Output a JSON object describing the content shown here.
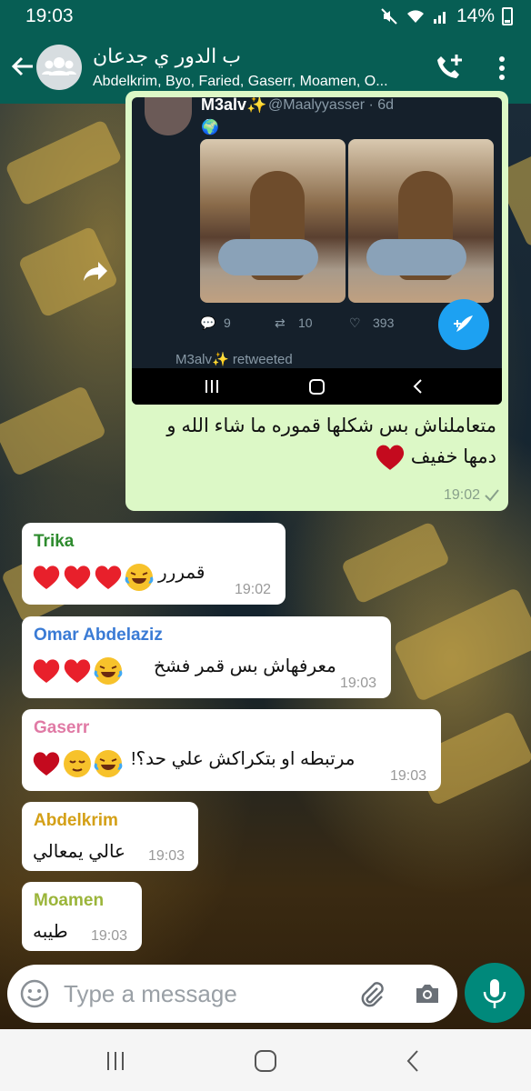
{
  "status_bar": {
    "time": "19:03",
    "battery": "14%"
  },
  "header": {
    "title": "ب الدور ي جدعان",
    "subtitle": "Abdelkrim, Byo, Faried, Gaserr, Moamen, O..."
  },
  "image_message": {
    "tweet": {
      "name": "M3alv✨",
      "handle": "@Maalyyasser · 6d",
      "replies": "9",
      "retweets": "10",
      "likes": "393",
      "retweeted_by": "M3alv✨ retweeted"
    },
    "caption": "متعاملناش بس شكلها قموره ما شاء الله و دمها خفيف",
    "time": "19:02"
  },
  "messages": [
    {
      "sender": "Trika",
      "sender_color": "#2e8b2e",
      "text": "قمررر",
      "time": "19:02"
    },
    {
      "sender": "Omar Abdelaziz",
      "sender_color": "#3a7bd5",
      "text": "معرفهاش بس قمر فشخ",
      "time": "19:03"
    },
    {
      "sender": "Gaserr",
      "sender_color": "#e07aa5",
      "text": "مرتبطه او بتكراكش علي حد؟!",
      "time": "19:03"
    },
    {
      "sender": "Abdelkrim",
      "sender_color": "#d4a017",
      "text": "عالي يمعالي",
      "time": "19:03"
    },
    {
      "sender": "Moamen",
      "sender_color": "#9bb53a",
      "text": "طيبه",
      "time": "19:03"
    }
  ],
  "composer": {
    "placeholder": "Type a message"
  },
  "colors": {
    "header": "#075e54",
    "outgoing": "#dcf8c6",
    "incoming": "#ffffff",
    "mic": "#00897b"
  }
}
